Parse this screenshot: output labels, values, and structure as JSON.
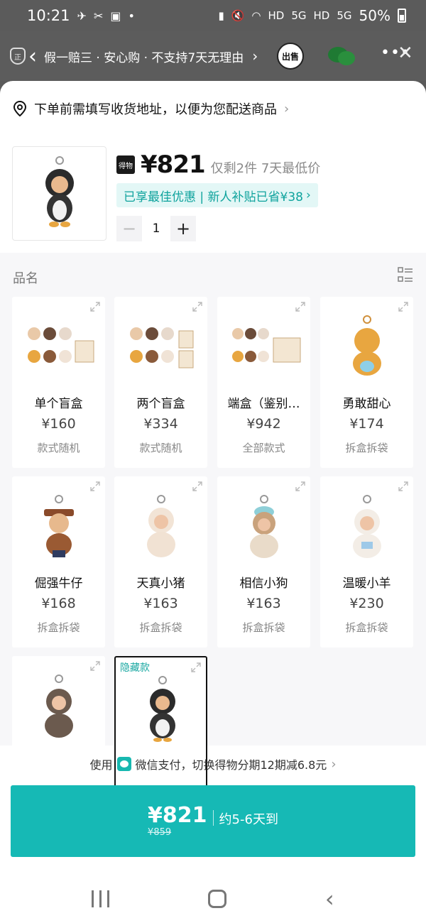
{
  "status_bar": {
    "time": "10:21",
    "hd1": "HD",
    "net1": "5G",
    "hd2": "HD",
    "net2": "5G",
    "battery": "50%"
  },
  "bg_header": {
    "guarantee_text": "假一赔三 · 安心购 · 不支持7天无理由",
    "sell_label": "出售"
  },
  "address": {
    "prompt": "下单前需填写收货地址，以便为您配送商品"
  },
  "product": {
    "brand_tag": "得物",
    "price": "¥821",
    "price_note": "仅剩2件 7天最低价",
    "promo": "已享最佳优惠 | 新人补贴已省¥38",
    "quantity": "1"
  },
  "options": {
    "title": "品名",
    "items": [
      {
        "name": "单个盲盒",
        "price": "¥160",
        "tag": "款式随机"
      },
      {
        "name": "两个盲盒",
        "price": "¥334",
        "tag": "款式随机"
      },
      {
        "name": "端盒（鉴别…",
        "price": "¥942",
        "tag": "全部款式"
      },
      {
        "name": "勇敢甜心",
        "price": "¥174",
        "tag": "拆盒拆袋"
      },
      {
        "name": "倔强牛仔",
        "price": "¥168",
        "tag": "拆盒拆袋"
      },
      {
        "name": "天真小猪",
        "price": "¥163",
        "tag": "拆盒拆袋"
      },
      {
        "name": "相信小狗",
        "price": "¥163",
        "tag": "拆盒拆袋"
      },
      {
        "name": "温暖小羊",
        "price": "¥230",
        "tag": "拆盒拆袋"
      },
      {
        "name": "",
        "price": "",
        "tag": ""
      },
      {
        "name": "",
        "price": "",
        "tag": "",
        "badge": "隐藏款",
        "selected": true
      }
    ]
  },
  "payment": {
    "prefix": "使用",
    "text": "微信支付，切换得物分期12期减6.8元"
  },
  "buy_button": {
    "price": "¥821",
    "original_price": "¥859",
    "eta": "约5-6天到"
  },
  "colors": {
    "accent": "#16b9b5",
    "promo_bg": "#e3f7f6",
    "promo_text": "#0fa39d"
  }
}
